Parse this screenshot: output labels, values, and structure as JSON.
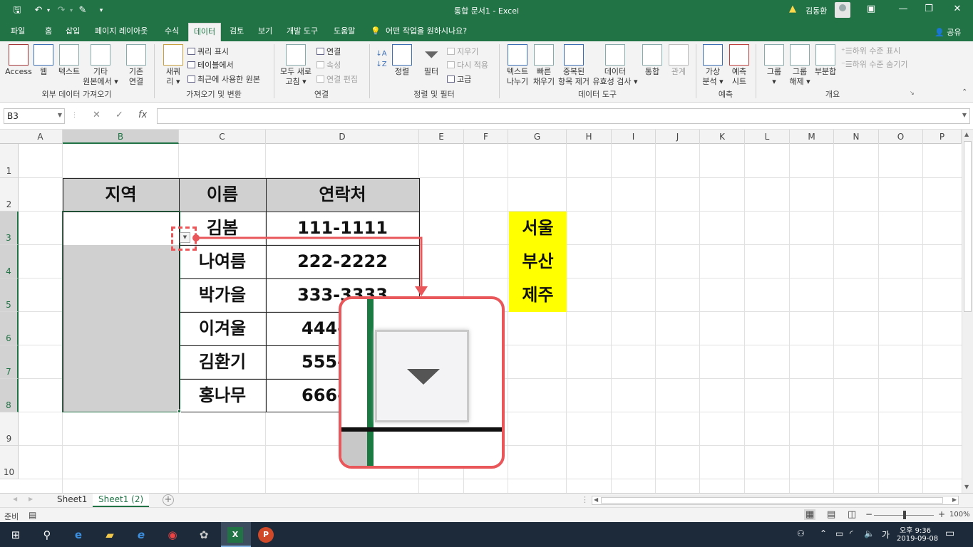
{
  "titlebar": {
    "title": "통합 문서1  -  Excel",
    "user": "김동환",
    "save_icon": "save-icon",
    "undo_icon": "undo-icon",
    "redo_icon": "redo-icon",
    "touch_icon": "touch-mode-icon",
    "customize_icon": "customize-icon",
    "ribbon_display_icon": "ribbon-display-icon",
    "min_icon": "minimize-icon",
    "max_icon": "restore-icon",
    "close_icon": "close-icon"
  },
  "tabs": {
    "file": "파일",
    "home": "홈",
    "insert": "삽입",
    "layout": "페이지 레이아웃",
    "formulas": "수식",
    "data": "데이터",
    "review": "검토",
    "view": "보기",
    "developer": "개발 도구",
    "help": "도움말",
    "tellme": "어떤 작업을 원하시나요?",
    "share": "공유"
  },
  "ribbon": {
    "access": "Access",
    "web": "웹",
    "text": "텍스트",
    "other_sources_1": "기타",
    "other_sources_2": "원본에서",
    "existing_1": "기존",
    "existing_2": "연결",
    "group_external": "외부 데이터 가져오기",
    "new_query_1": "새쿼",
    "new_query_2": "리",
    "show_queries": "쿼리 표시",
    "from_table": "테이블에서",
    "recent_sources": "최근에 사용한 원본",
    "group_get_transform": "가져오기 및 변환",
    "refresh_all_1": "모두 새로",
    "refresh_all_2": "고침",
    "connections": "연결",
    "properties": "속성",
    "edit_links": "연결 편집",
    "group_connections": "연결",
    "sort": "정렬",
    "filter": "필터",
    "clear": "지우기",
    "reapply": "다시 적용",
    "advanced": "고급",
    "group_sort_filter": "정렬 및 필터",
    "text_to_columns_1": "텍스트",
    "text_to_columns_2": "나누기",
    "flash_fill_1": "빠른",
    "flash_fill_2": "채우기",
    "remove_dup_1": "중복된",
    "remove_dup_2": "항목 제거",
    "validation_1": "데이터",
    "validation_2": "유효성 검사",
    "consolidate": "통합",
    "relationships": "관계",
    "group_data_tools": "데이터 도구",
    "whatif_1": "가상",
    "whatif_2": "분석",
    "forecast_1": "예측",
    "forecast_2": "시트",
    "group_forecast": "예측",
    "group_1": "그룹",
    "ungroup_1": "그룹",
    "ungroup_2": "해제",
    "subtotal": "부분합",
    "show_detail": "하위 수준 표시",
    "hide_detail": "하위 수준 숨기기",
    "group_outline": "개요"
  },
  "formula_bar": {
    "name_box": "B3",
    "cancel": "✕",
    "enter": "✓",
    "fx": "fx",
    "value": ""
  },
  "columns": [
    "A",
    "B",
    "C",
    "D",
    "E",
    "F",
    "G",
    "H",
    "I",
    "J",
    "K",
    "L",
    "M",
    "N",
    "O",
    "P"
  ],
  "rows": [
    "1",
    "2",
    "3",
    "4",
    "5",
    "6",
    "7",
    "8",
    "9",
    "10"
  ],
  "table": {
    "header_region": "지역",
    "header_name": "이름",
    "header_contact": "연락처",
    "names": [
      "김봄",
      "나여름",
      "박가을",
      "이겨울",
      "김환기",
      "홍나무"
    ],
    "contacts": [
      "111-1111",
      "222-2222",
      "333-3333",
      "444-",
      "555-",
      "666-"
    ]
  },
  "side_list": [
    "서울",
    "부산",
    "제주"
  ],
  "sheets": [
    "Sheet1",
    "Sheet1 (2)"
  ],
  "status": {
    "ready": "준비",
    "zoom": "100%"
  },
  "taskbar": {
    "time": "오후 9:36",
    "date": "2019-09-08",
    "ime": "가"
  },
  "colors": {
    "excel_green": "#217346",
    "highlight_red": "#e9575b",
    "yellow": "#ffff00",
    "gray_cell": "#d0d0d0"
  }
}
